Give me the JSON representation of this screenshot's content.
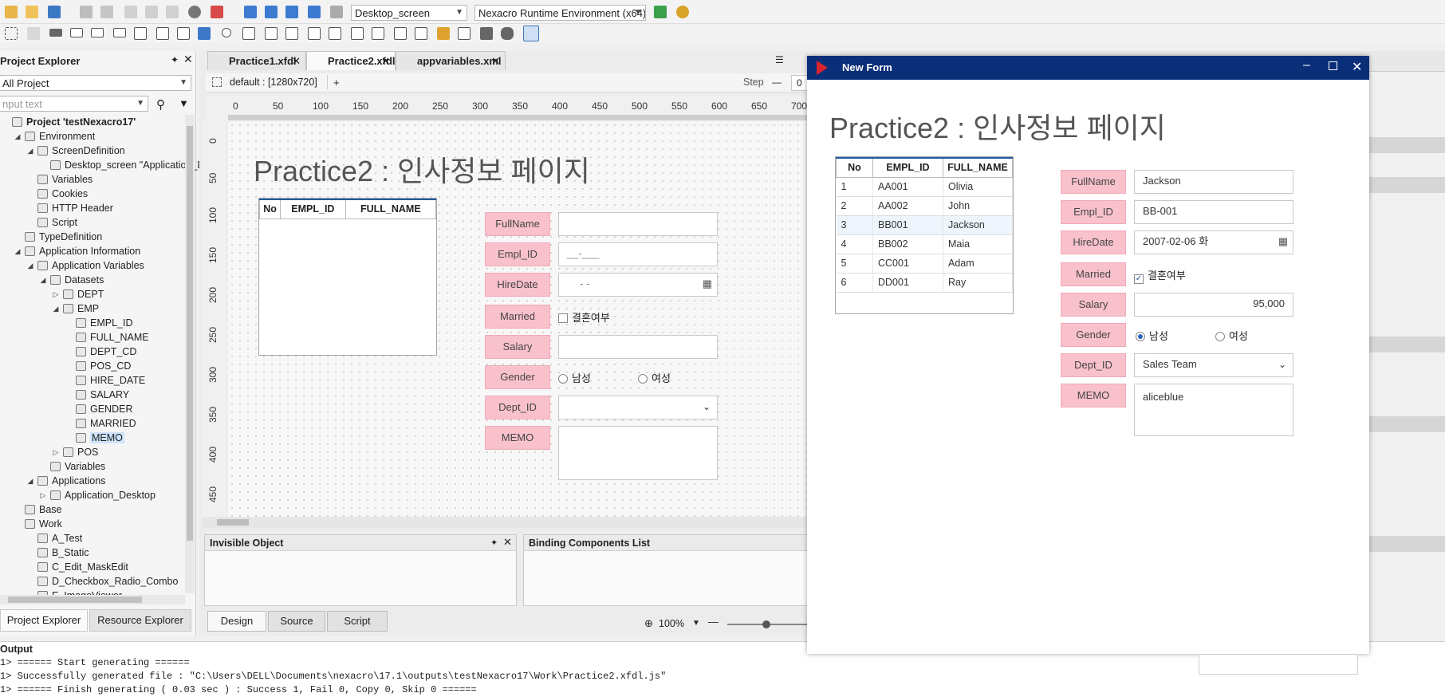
{
  "toolbar": {
    "screen_combo": "Desktop_screen",
    "runtime_combo": "Nexacro Runtime Environment (x64)"
  },
  "project_explorer": {
    "title": "Project Explorer",
    "filter": "All Project",
    "search_placeholder": "nput text",
    "tree": [
      {
        "label": "Project 'testNexacro17'",
        "indent": 0
      },
      {
        "label": "Environment",
        "indent": 1
      },
      {
        "label": "ScreenDefinition",
        "indent": 2
      },
      {
        "label": "Desktop_screen \"Application_D",
        "indent": 3
      },
      {
        "label": "Variables",
        "indent": 2
      },
      {
        "label": "Cookies",
        "indent": 2
      },
      {
        "label": "HTTP Header",
        "indent": 2
      },
      {
        "label": "Script",
        "indent": 2
      },
      {
        "label": "TypeDefinition",
        "indent": 1
      },
      {
        "label": "Application Information",
        "indent": 1
      },
      {
        "label": "Application Variables",
        "indent": 2
      },
      {
        "label": "Datasets",
        "indent": 3
      },
      {
        "label": "DEPT",
        "indent": 4
      },
      {
        "label": "EMP",
        "indent": 4
      },
      {
        "label": "EMPL_ID",
        "indent": 5
      },
      {
        "label": "FULL_NAME",
        "indent": 5
      },
      {
        "label": "DEPT_CD",
        "indent": 5
      },
      {
        "label": "POS_CD",
        "indent": 5
      },
      {
        "label": "HIRE_DATE",
        "indent": 5
      },
      {
        "label": "SALARY",
        "indent": 5
      },
      {
        "label": "GENDER",
        "indent": 5
      },
      {
        "label": "MARRIED",
        "indent": 5
      },
      {
        "label": "MEMO",
        "indent": 5
      },
      {
        "label": "POS",
        "indent": 4
      },
      {
        "label": "Variables",
        "indent": 3
      },
      {
        "label": "Applications",
        "indent": 2
      },
      {
        "label": "Application_Desktop",
        "indent": 3
      },
      {
        "label": "Base",
        "indent": 1
      },
      {
        "label": "Work",
        "indent": 1
      },
      {
        "label": "A_Test",
        "indent": 2
      },
      {
        "label": "B_Static",
        "indent": 2
      },
      {
        "label": "C_Edit_MaskEdit",
        "indent": 2
      },
      {
        "label": "D_Checkbox_Radio_Combo",
        "indent": 2
      },
      {
        "label": "E_ImageViewer",
        "indent": 2
      }
    ],
    "bottom_tabs": [
      "Project Explorer",
      "Resource Explorer"
    ]
  },
  "editor": {
    "tabs": [
      "Practice1.xfdl",
      "Practice2.xfdl",
      "appvariables.xml"
    ],
    "screen_label": "default : [1280x720]",
    "plus": "+",
    "step_label": "Step",
    "step_value": "0",
    "ruler_h": [
      "0",
      "50",
      "100",
      "150",
      "200",
      "250",
      "300",
      "350",
      "400",
      "450",
      "500",
      "550",
      "600",
      "650",
      "700"
    ],
    "ruler_v": [
      "0",
      "50",
      "100",
      "150",
      "200",
      "250",
      "300",
      "350",
      "400",
      "450"
    ],
    "bottom_tabs": [
      "Design",
      "Source",
      "Script"
    ],
    "zoom": "100%"
  },
  "design_form": {
    "title": "Practice2 : 인사정보 페이지",
    "grid_headers": [
      "No",
      "EMPL_ID",
      "FULL_NAME"
    ],
    "labels": [
      "FullName",
      "Empl_ID",
      "HireDate",
      "Married",
      "Salary",
      "Gender",
      "Dept_ID",
      "MEMO"
    ],
    "empl_mask": "__-___",
    "date_mask": "-  -",
    "married_text": "결혼여부",
    "gender_male": "남성",
    "gender_female": "여성"
  },
  "panels": {
    "invisible_object": "Invisible Object",
    "binding_list": "Binding Components List"
  },
  "output": {
    "title": "Output",
    "lines": [
      "1> ====== Start generating ======",
      "1> Successfully generated file : \"C:\\Users\\DELL\\Documents\\nexacro\\17.1\\outputs\\testNexacro17\\Work\\Practice2.xfdl.js\"",
      "1> ====== Finish generating ( 0.03 sec ) : Success 1, Fail 0, Copy 0, Skip 0 ======"
    ]
  },
  "runtime_window": {
    "title": "New Form",
    "form_title": "Practice2 : 인사정보 페이지",
    "grid_headers": [
      "No",
      "EMPL_ID",
      "FULL_NAME"
    ],
    "grid_rows": [
      [
        "1",
        "AA001",
        "Olivia"
      ],
      [
        "2",
        "AA002",
        "John"
      ],
      [
        "3",
        "BB001",
        "Jackson"
      ],
      [
        "4",
        "BB002",
        "Maia"
      ],
      [
        "5",
        "CC001",
        "Adam"
      ],
      [
        "6",
        "DD001",
        "Ray"
      ]
    ],
    "labels": [
      "FullName",
      "Empl_ID",
      "HireDate",
      "Married",
      "Salary",
      "Gender",
      "Dept_ID",
      "MEMO"
    ],
    "fullname": "Jackson",
    "empl_id": "BB-001",
    "hire_date": "2007-02-06 화",
    "married_text": "결혼여부",
    "married_checked": true,
    "salary": "95,000",
    "gender_male": "남성",
    "gender_female": "여성",
    "gender_selected": "남성",
    "dept": "Sales Team",
    "memo": "aliceblue",
    "title_bar_color": "#0b2e79"
  }
}
